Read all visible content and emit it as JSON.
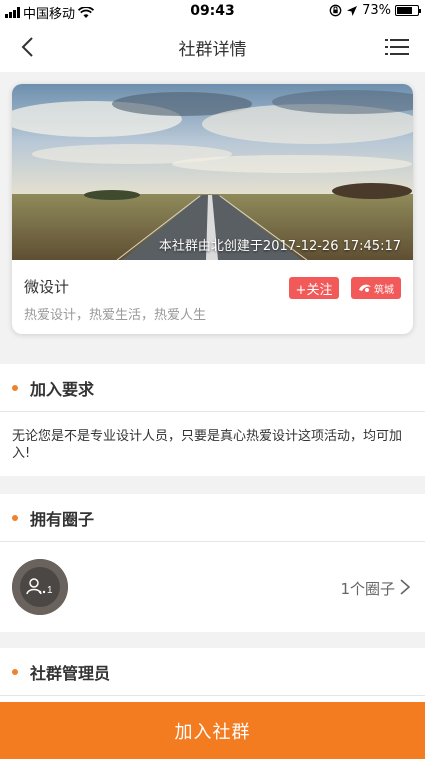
{
  "status_bar": {
    "carrier": "中国移动",
    "time": "09:43",
    "battery": "73%",
    "battery_level": 0.73
  },
  "nav": {
    "title": "社群详情",
    "back_icon": "chevron-left-icon",
    "menu_icon": "list-menu-icon"
  },
  "group": {
    "cover_caption": "本社群由北创建于2017-12-26 17:45:17",
    "name": "微设计",
    "motto": "热爱设计，热爱生活，热爱人生",
    "follow_label": "+关注",
    "badge_label": "筑城"
  },
  "join_requirements": {
    "title": "加入要求",
    "text": "无论您是不是专业设计人员，只要是真心热爱设计这项活动，均可加入!"
  },
  "circles": {
    "title": "拥有圈子",
    "count_label": "1个圈子"
  },
  "admins": {
    "title": "社群管理员"
  },
  "join_button": "加入社群",
  "colors": {
    "accent": "#f37b20",
    "follow": "#f25959",
    "dot": "#f0822d"
  }
}
